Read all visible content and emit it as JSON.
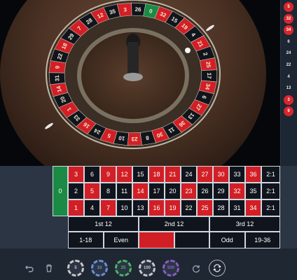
{
  "history": {
    "results": [
      {
        "value": "5",
        "color": "red"
      },
      {
        "value": "32",
        "color": "red"
      },
      {
        "value": "34",
        "color": "red"
      },
      {
        "value": "6",
        "color": "black"
      },
      {
        "value": "24",
        "color": "black"
      },
      {
        "value": "22",
        "color": "black"
      },
      {
        "value": "4",
        "color": "black"
      },
      {
        "value": "13",
        "color": "black"
      },
      {
        "value": "3",
        "color": "red"
      },
      {
        "value": "9",
        "color": "red"
      }
    ]
  },
  "wheel": {
    "sequence": [
      "0",
      "32",
      "15",
      "19",
      "4",
      "21",
      "2",
      "25",
      "17",
      "34",
      "6",
      "27",
      "13",
      "36",
      "11",
      "30",
      "8",
      "23",
      "10",
      "5",
      "24",
      "16",
      "33",
      "1",
      "20",
      "14",
      "31",
      "9",
      "22",
      "18",
      "29",
      "7",
      "28",
      "12",
      "35",
      "3",
      "26"
    ],
    "red_numbers": [
      1,
      3,
      5,
      7,
      9,
      12,
      14,
      16,
      18,
      19,
      21,
      23,
      25,
      27,
      30,
      32,
      34,
      36
    ]
  },
  "board": {
    "zero": "0",
    "rows": [
      [
        "3",
        "6",
        "9",
        "12",
        "15",
        "18",
        "21",
        "24",
        "27",
        "30",
        "33",
        "36"
      ],
      [
        "2",
        "5",
        "8",
        "11",
        "14",
        "17",
        "20",
        "23",
        "26",
        "29",
        "32",
        "35"
      ],
      [
        "1",
        "4",
        "7",
        "10",
        "13",
        "16",
        "19",
        "22",
        "25",
        "28",
        "31",
        "34"
      ]
    ],
    "column_labels": [
      "2:1",
      "2:1",
      "2:1"
    ],
    "dozens": [
      "1st 12",
      "2nd 12",
      "3rd 12"
    ],
    "outside": {
      "low": "1-18",
      "even": "Even",
      "odd": "Odd",
      "high": "19-36"
    }
  },
  "controls": {
    "chips": [
      {
        "value": "5",
        "color": "#c9c9c9"
      },
      {
        "value": "10",
        "color": "#6a8fd6"
      },
      {
        "value": "25",
        "color": "#4fb364"
      },
      {
        "value": "100",
        "color": "#c9c9c9"
      },
      {
        "value": "500",
        "color": "#8b5cc7"
      }
    ],
    "colors": {
      "red": "#d21f26",
      "black": "#10151d",
      "green": "#1b8a44",
      "panel": "#2b3543"
    }
  }
}
